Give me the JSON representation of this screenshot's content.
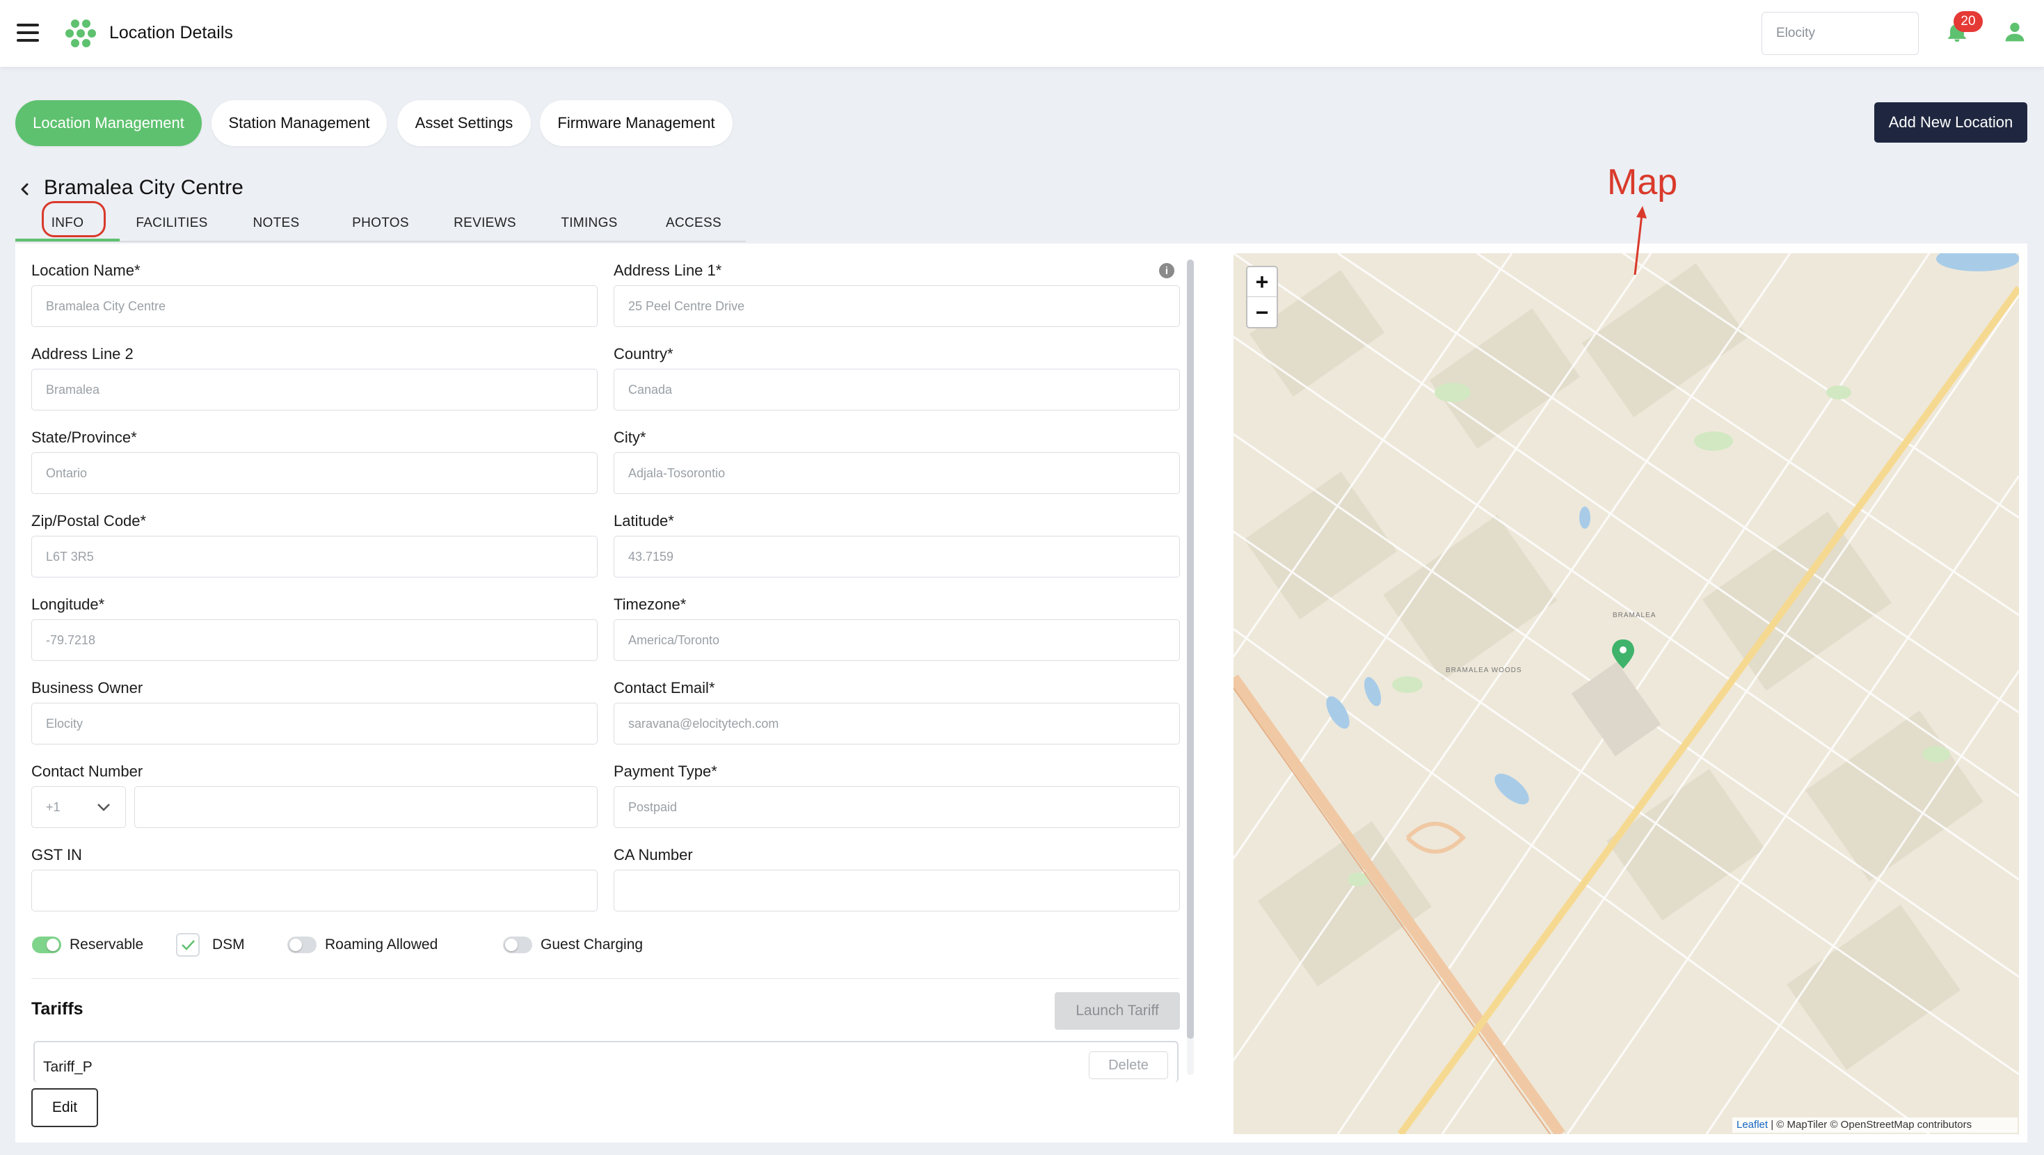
{
  "header": {
    "title": "Location Details",
    "org_value": "Elocity",
    "notification_count": "20"
  },
  "main_tabs": [
    {
      "label": "Location Management",
      "active": true
    },
    {
      "label": "Station Management",
      "active": false
    },
    {
      "label": "Asset Settings",
      "active": false
    },
    {
      "label": "Firmware Management",
      "active": false
    }
  ],
  "add_location_label": "Add New Location",
  "location": {
    "name": "Bramalea City Centre"
  },
  "sub_tabs": [
    "INFO",
    "FACILITIES",
    "NOTES",
    "PHOTOS",
    "REVIEWS",
    "TIMINGS",
    "ACCESS"
  ],
  "fields": {
    "location_name": {
      "label": "Location Name*",
      "value": "Bramalea City Centre"
    },
    "address_line_1": {
      "label": "Address Line 1*",
      "value": "25 Peel Centre Drive"
    },
    "address_line_2": {
      "label": "Address Line 2",
      "value": "Bramalea"
    },
    "country": {
      "label": "Country*",
      "value": "Canada"
    },
    "state": {
      "label": "State/Province*",
      "value": "Ontario"
    },
    "city": {
      "label": "City*",
      "value": "Adjala-Tosorontio"
    },
    "zip": {
      "label": "Zip/Postal Code*",
      "value": "L6T 3R5"
    },
    "latitude": {
      "label": "Latitude*",
      "value": "43.7159"
    },
    "longitude": {
      "label": "Longitude*",
      "value": "-79.7218"
    },
    "timezone": {
      "label": "Timezone*",
      "value": "America/Toronto"
    },
    "business_owner": {
      "label": "Business Owner",
      "value": "Elocity"
    },
    "contact_email": {
      "label": "Contact Email*",
      "value": "saravana@elocitytech.com"
    },
    "contact_number": {
      "label": "Contact Number",
      "country_code": "+1",
      "value": ""
    },
    "payment_type": {
      "label": "Payment Type*",
      "value": "Postpaid"
    },
    "gst_in": {
      "label": "GST IN",
      "value": ""
    },
    "ca_number": {
      "label": "CA Number",
      "value": ""
    }
  },
  "toggles": {
    "reservable": {
      "label": "Reservable",
      "on": true
    },
    "dsm": {
      "label": "DSM",
      "checked": true
    },
    "roaming": {
      "label": "Roaming Allowed",
      "on": false
    },
    "guest_charging": {
      "label": "Guest Charging",
      "on": false
    }
  },
  "tariffs": {
    "title": "Tariffs",
    "launch_label": "Launch Tariff",
    "items": [
      {
        "name": "Tariff_P",
        "delete_label": "Delete"
      }
    ]
  },
  "edit_label": "Edit",
  "map": {
    "annotation": "Map",
    "zoom_in": "+",
    "zoom_out": "−",
    "attribution_leaflet": "Leaflet",
    "attribution_rest": "| © MapTiler © OpenStreetMap contributors",
    "marker_color": "#3fb36b",
    "labels": [
      "BRAMALEA",
      "BRAMALEA WOODS"
    ]
  },
  "colors": {
    "accent_green": "#5ec16f",
    "navy": "#1f2740",
    "annotation_red": "#d93a2b"
  }
}
